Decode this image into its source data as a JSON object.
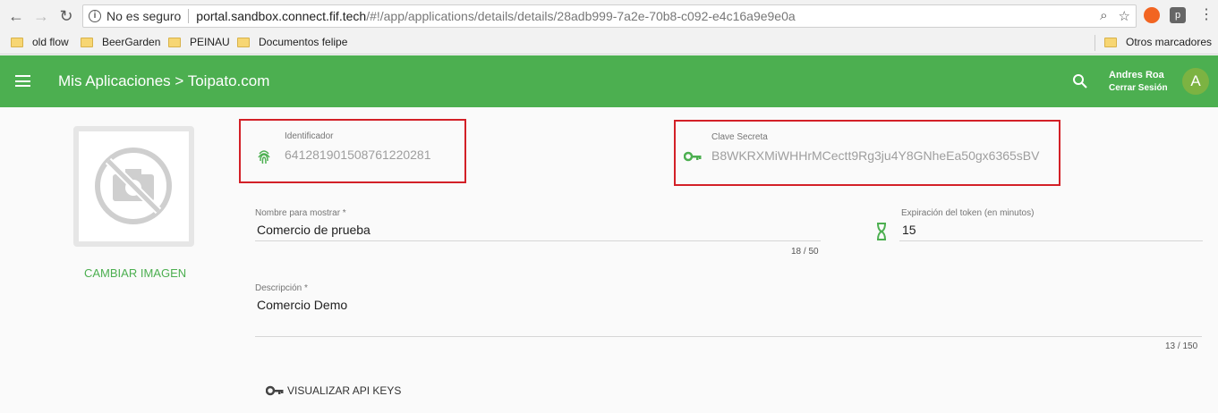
{
  "browser": {
    "security_label": "No es seguro",
    "url_host": "portal.sandbox.connect.fif.tech",
    "url_path": "/#!/app/applications/details/details/28adb999-7a2e-70b8-c092-e4c16a9e9e0a",
    "ext_p_label": "p",
    "bookmarks": [
      "old flow",
      "BeerGarden",
      "PEINAU",
      "Documentos felipe"
    ],
    "other_bookmarks": "Otros marcadores"
  },
  "header": {
    "title": "Mis Aplicaciones > Toipato.com",
    "user_name": "Andres Roa",
    "logout": "Cerrar Sesión",
    "avatar_letter": "A",
    "color": "#4caf50"
  },
  "image": {
    "change_label": "CAMBIAR IMAGEN"
  },
  "identifier": {
    "label": "Identificador",
    "value": "641281901508761220281"
  },
  "secret": {
    "label": "Clave Secreta",
    "value": "B8WKRXMiWHHrMCectt9Rg3ju4Y8GNheEa50gx6365sBV"
  },
  "display_name": {
    "label": "Nombre para mostrar *",
    "value": "Comercio de prueba",
    "counter": "18 / 50"
  },
  "token_expiration": {
    "label": "Expiración del token (en minutos)",
    "value": "15"
  },
  "description": {
    "label": "Descripción *",
    "value": "Comercio Demo",
    "counter": "13 / 150"
  },
  "api_keys": {
    "label": "VISUALIZAR API KEYS"
  }
}
